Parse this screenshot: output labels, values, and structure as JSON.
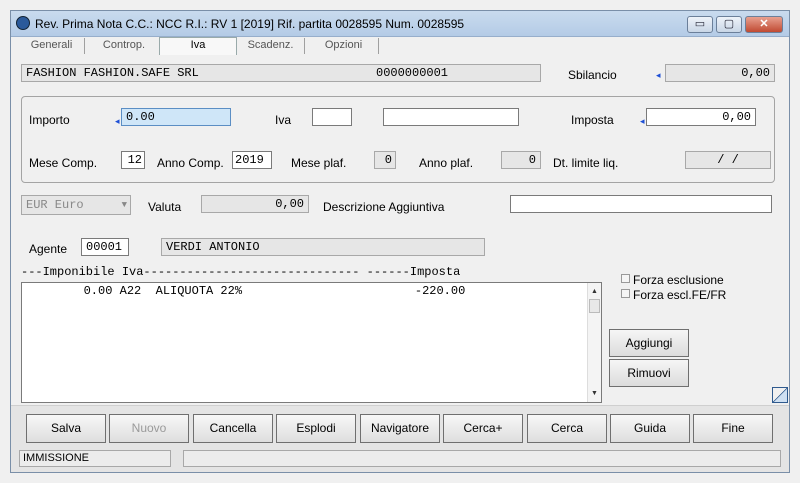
{
  "window": {
    "title": "Rev. Prima Nota C.C.: NCC  R.I.: RV      1 [2019]   Rif. partita 0028595 Num. 0028595",
    "minimize_glyph": "▭",
    "maximize_glyph": "▢",
    "close_glyph": "✕"
  },
  "tabs": [
    {
      "label": "Generali"
    },
    {
      "label": "Controp."
    },
    {
      "label": "Iva"
    },
    {
      "label": "Scadenz."
    },
    {
      "label": "Opzioni"
    }
  ],
  "header": {
    "customer": "FASHION    FASHION.SAFE SRL",
    "code": "0000000001",
    "sbilancio_label": "Sbilancio",
    "sbilancio_value": "0,00"
  },
  "form": {
    "importo_label": "Importo",
    "importo_value": "0.00",
    "iva_label": "Iva",
    "iva_code": "",
    "iva_desc": "",
    "imposta_label": "Imposta",
    "imposta_value": "0,00",
    "mese_comp_label": "Mese Comp.",
    "mese_comp_value": "12",
    "anno_comp_label": "Anno Comp.",
    "anno_comp_value": "2019",
    "mese_plaf_label": "Mese plaf.",
    "mese_plaf_value": "0",
    "anno_plaf_label": "Anno plaf.",
    "anno_plaf_value": "0",
    "dt_limite_label": "Dt. limite liq.",
    "dt_limite_value": "/   /"
  },
  "currency": {
    "combo_value": "EUR Euro",
    "valuta_label": "Valuta",
    "valuta_value": "0,00",
    "descr_label": "Descrizione Aggiuntiva",
    "descr_value": ""
  },
  "agent": {
    "label": "Agente",
    "code": "00001",
    "name": "VERDI ANTONIO"
  },
  "list": {
    "header": "---Imponibile Iva------------------------------ ------Imposta",
    "rows": [
      {
        "text": "        0.00 A22  ALIQUOTA 22%                        -220.00"
      }
    ]
  },
  "options": {
    "forza_esclusione": "Forza esclusione",
    "forza_escl_fefr": "Forza escl.FE/FR"
  },
  "side_buttons": {
    "aggiungi": "Aggiungi",
    "rimuovi": "Rimuovi"
  },
  "buttons": {
    "salva": "Salva",
    "nuovo": "Nuovo",
    "cancella": "Cancella",
    "esplodi": "Esplodi",
    "navigatore": "Navigatore",
    "cerca_plus": "Cerca+",
    "cerca": "Cerca",
    "guida": "Guida",
    "fine": "Fine"
  },
  "status": {
    "mode": "IMMISSIONE",
    "message": ""
  }
}
